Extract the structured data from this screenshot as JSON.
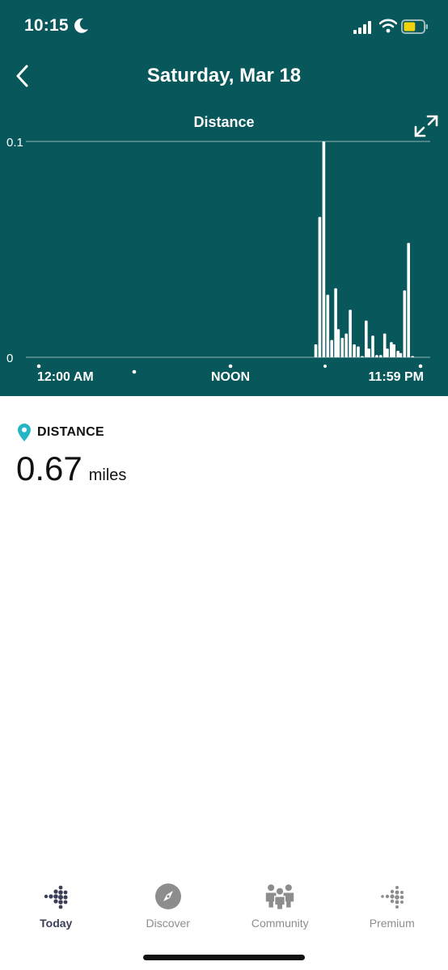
{
  "status_bar": {
    "time": "10:15",
    "battery_level": 0.6,
    "battery_color": "#f2d20c"
  },
  "header": {
    "title": "Saturday, Mar 18"
  },
  "chart_data": {
    "type": "bar",
    "title": "Distance",
    "x_tick_labels": [
      "12:00 AM",
      "NOON",
      "11:59 PM"
    ],
    "y_tick_labels": [
      "0.1",
      "0"
    ],
    "ylim": [
      0,
      0.1
    ],
    "x_range_minutes": [
      0,
      1440
    ],
    "grid": true,
    "x_unit": "minutes since midnight",
    "x": [
      1045,
      1060,
      1075,
      1090,
      1105,
      1120,
      1130,
      1145,
      1160,
      1175,
      1190,
      1205,
      1220,
      1235,
      1245,
      1260,
      1275,
      1290,
      1305,
      1315,
      1330,
      1340,
      1355,
      1365,
      1380,
      1395,
      1410
    ],
    "values": [
      0.006,
      0.065,
      0.1,
      0.029,
      0.008,
      0.032,
      0.013,
      0.009,
      0.011,
      0.022,
      0.006,
      0.005,
      0.0,
      0.017,
      0.004,
      0.01,
      0.001,
      0.001,
      0.011,
      0.004,
      0.007,
      0.006,
      0.003,
      0.002,
      0.031,
      0.053,
      0.0
    ]
  },
  "metric": {
    "label": "DISTANCE",
    "value": "0.67",
    "unit": "miles"
  },
  "accent_color": "#07575b",
  "pin_color": "#24b6c5",
  "tabs": [
    {
      "label": "Today",
      "icon": "fitbit-dots-icon",
      "active": true
    },
    {
      "label": "Discover",
      "icon": "compass-icon",
      "active": false
    },
    {
      "label": "Community",
      "icon": "community-icon",
      "active": false
    },
    {
      "label": "Premium",
      "icon": "premium-dots-icon",
      "active": false
    }
  ]
}
